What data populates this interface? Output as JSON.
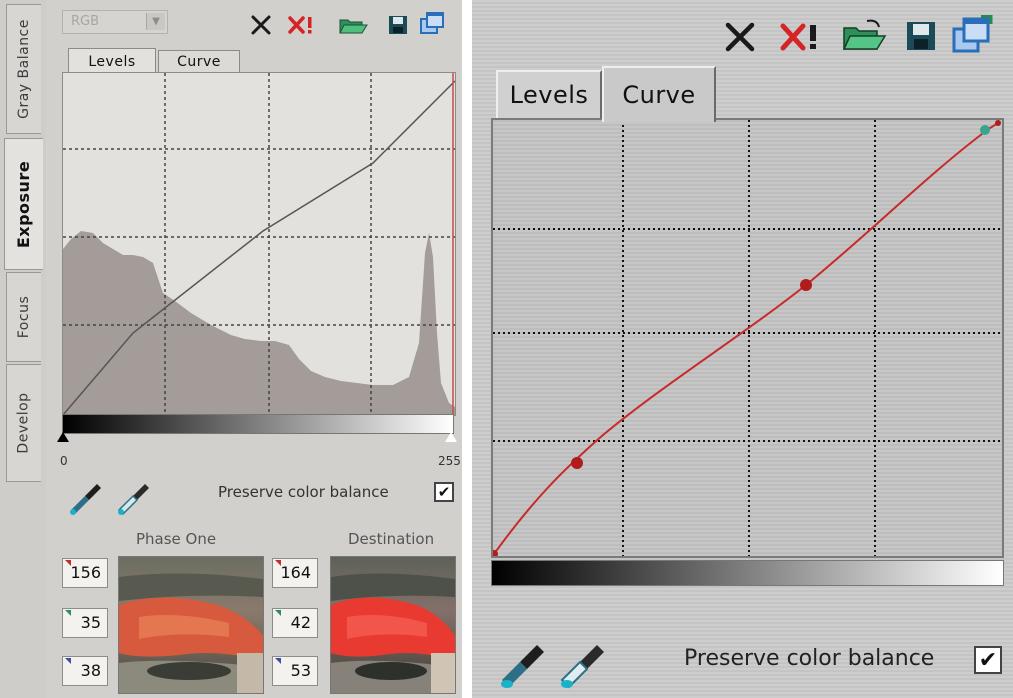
{
  "left": {
    "vertical_tabs": [
      {
        "label": "Gray Balance",
        "active": false
      },
      {
        "label": "Exposure",
        "active": true
      },
      {
        "label": "Focus",
        "active": false
      },
      {
        "label": "Develop",
        "active": false
      }
    ],
    "channel_select": "RGB",
    "tabs": [
      {
        "label": "Levels",
        "active": true
      },
      {
        "label": "Curve",
        "active": false
      }
    ],
    "axis_min": "0",
    "axis_max": "255",
    "preserve_label": "Preserve color balance",
    "preserve_checked": true,
    "source_title": "Phase One",
    "dest_title": "Destination",
    "source_values": [
      "156",
      "35",
      "38"
    ],
    "dest_values": [
      "164",
      "42",
      "53"
    ]
  },
  "right": {
    "tabs": [
      {
        "label": "Levels",
        "active": false
      },
      {
        "label": "Curve",
        "active": true
      }
    ],
    "preserve_label": "Preserve color balance",
    "preserve_checked": true,
    "curve_points": [
      [
        0,
        0
      ],
      [
        64,
        84
      ],
      [
        247,
        252
      ],
      [
        255,
        255
      ]
    ]
  },
  "icons": [
    "cancel-icon",
    "cancel-all-icon",
    "open-folder-icon",
    "save-disk-icon",
    "copy-windows-icon",
    "picker-dark-icon",
    "picker-light-icon"
  ],
  "colors": {
    "curve": "#c82a2a",
    "cancel": "#1a1a1a",
    "cancel_all": "#d42424",
    "folder": "#2f8f5a",
    "disk": "#1c4a56",
    "windows": "#2a6db8",
    "histogram": "#a49c98",
    "channel_red": "#c0302e",
    "channel_green": "#2e8f5a",
    "channel_blue": "#3b4ea8"
  }
}
